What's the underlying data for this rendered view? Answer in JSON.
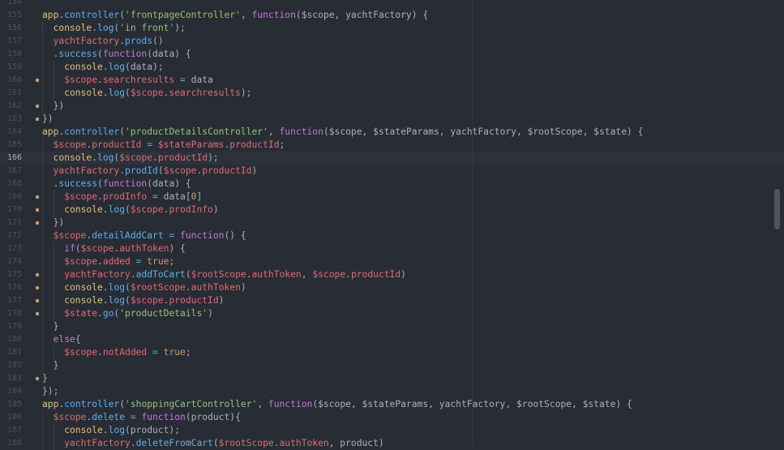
{
  "editor": {
    "current_line": 166,
    "lines": [
      {
        "num": 154,
        "indent": 0,
        "mark": false,
        "tokens": []
      },
      {
        "num": 155,
        "indent": 0,
        "mark": false,
        "tokens": [
          {
            "t": "app",
            "c": "y"
          },
          {
            "t": ".",
            "c": "p"
          },
          {
            "t": "controller",
            "c": "fn"
          },
          {
            "t": "(",
            "c": "p"
          },
          {
            "t": "'frontpageController'",
            "c": "s"
          },
          {
            "t": ", ",
            "c": "p"
          },
          {
            "t": "function",
            "c": "k"
          },
          {
            "t": "($scope, yachtFactory) {",
            "c": "p"
          }
        ]
      },
      {
        "num": 156,
        "indent": 1,
        "mark": false,
        "tokens": [
          {
            "t": "console",
            "c": "y"
          },
          {
            "t": ".",
            "c": "p"
          },
          {
            "t": "log",
            "c": "fn"
          },
          {
            "t": "(",
            "c": "p"
          },
          {
            "t": "'in front'",
            "c": "s"
          },
          {
            "t": ");",
            "c": "p"
          }
        ]
      },
      {
        "num": 157,
        "indent": 1,
        "mark": false,
        "tokens": [
          {
            "t": "yachtFactory",
            "c": "v"
          },
          {
            "t": ".",
            "c": "p"
          },
          {
            "t": "prods",
            "c": "fn"
          },
          {
            "t": "()",
            "c": "p"
          }
        ]
      },
      {
        "num": 158,
        "indent": 1,
        "mark": false,
        "tokens": [
          {
            "t": ".",
            "c": "p"
          },
          {
            "t": "success",
            "c": "fn"
          },
          {
            "t": "(",
            "c": "p"
          },
          {
            "t": "function",
            "c": "k"
          },
          {
            "t": "(data) {",
            "c": "p"
          }
        ]
      },
      {
        "num": 159,
        "indent": 2,
        "mark": false,
        "tokens": [
          {
            "t": "console",
            "c": "y"
          },
          {
            "t": ".",
            "c": "p"
          },
          {
            "t": "log",
            "c": "fn"
          },
          {
            "t": "(data);",
            "c": "p"
          }
        ]
      },
      {
        "num": 160,
        "indent": 2,
        "mark": true,
        "tokens": [
          {
            "t": "$scope",
            "c": "v"
          },
          {
            "t": ".",
            "c": "p"
          },
          {
            "t": "searchresults",
            "c": "v"
          },
          {
            "t": " = ",
            "c": "o"
          },
          {
            "t": "data",
            "c": "p"
          }
        ]
      },
      {
        "num": 161,
        "indent": 2,
        "mark": false,
        "tokens": [
          {
            "t": "console",
            "c": "y"
          },
          {
            "t": ".",
            "c": "p"
          },
          {
            "t": "log",
            "c": "fn"
          },
          {
            "t": "(",
            "c": "p"
          },
          {
            "t": "$scope",
            "c": "v"
          },
          {
            "t": ".",
            "c": "p"
          },
          {
            "t": "searchresults",
            "c": "v"
          },
          {
            "t": ");",
            "c": "p"
          }
        ]
      },
      {
        "num": 162,
        "indent": 1,
        "mark": true,
        "tokens": [
          {
            "t": "})",
            "c": "p"
          }
        ]
      },
      {
        "num": 163,
        "indent": 0,
        "mark": true,
        "tokens": [
          {
            "t": "})",
            "c": "p"
          }
        ]
      },
      {
        "num": 164,
        "indent": 0,
        "mark": false,
        "tokens": [
          {
            "t": "app",
            "c": "y"
          },
          {
            "t": ".",
            "c": "p"
          },
          {
            "t": "controller",
            "c": "fn"
          },
          {
            "t": "(",
            "c": "p"
          },
          {
            "t": "'productDetailsController'",
            "c": "s"
          },
          {
            "t": ", ",
            "c": "p"
          },
          {
            "t": "function",
            "c": "k"
          },
          {
            "t": "($scope, $stateParams, yachtFactory, $rootScope, $state) {",
            "c": "p"
          }
        ]
      },
      {
        "num": 165,
        "indent": 1,
        "mark": false,
        "tokens": [
          {
            "t": "$scope",
            "c": "v"
          },
          {
            "t": ".",
            "c": "p"
          },
          {
            "t": "productId",
            "c": "v"
          },
          {
            "t": " = ",
            "c": "o"
          },
          {
            "t": "$stateParams",
            "c": "v"
          },
          {
            "t": ".",
            "c": "p"
          },
          {
            "t": "productId",
            "c": "v"
          },
          {
            "t": ";",
            "c": "p"
          }
        ]
      },
      {
        "num": 166,
        "indent": 1,
        "mark": false,
        "tokens": [
          {
            "t": "console",
            "c": "y"
          },
          {
            "t": ".",
            "c": "p"
          },
          {
            "t": "log",
            "c": "fn"
          },
          {
            "t": "(",
            "c": "p"
          },
          {
            "t": "$scope",
            "c": "v"
          },
          {
            "t": ".",
            "c": "p"
          },
          {
            "t": "productId",
            "c": "v"
          },
          {
            "t": ");",
            "c": "p"
          }
        ]
      },
      {
        "num": 167,
        "indent": 1,
        "mark": false,
        "tokens": [
          {
            "t": "yachtFactory",
            "c": "v"
          },
          {
            "t": ".",
            "c": "p"
          },
          {
            "t": "prodId",
            "c": "fn"
          },
          {
            "t": "(",
            "c": "p"
          },
          {
            "t": "$scope",
            "c": "v"
          },
          {
            "t": ".",
            "c": "p"
          },
          {
            "t": "productId",
            "c": "v"
          },
          {
            "t": ")",
            "c": "p"
          }
        ]
      },
      {
        "num": 168,
        "indent": 1,
        "mark": false,
        "tokens": [
          {
            "t": ".",
            "c": "p"
          },
          {
            "t": "success",
            "c": "fn"
          },
          {
            "t": "(",
            "c": "p"
          },
          {
            "t": "function",
            "c": "k"
          },
          {
            "t": "(data) {",
            "c": "p"
          }
        ]
      },
      {
        "num": 169,
        "indent": 2,
        "mark": true,
        "tokens": [
          {
            "t": "$scope",
            "c": "v"
          },
          {
            "t": ".",
            "c": "p"
          },
          {
            "t": "prodInfo",
            "c": "v"
          },
          {
            "t": " = ",
            "c": "o"
          },
          {
            "t": "data[",
            "c": "p"
          },
          {
            "t": "0",
            "c": "n"
          },
          {
            "t": "]",
            "c": "p"
          }
        ]
      },
      {
        "num": 170,
        "indent": 2,
        "mark": true,
        "tokens": [
          {
            "t": "console",
            "c": "y"
          },
          {
            "t": ".",
            "c": "p"
          },
          {
            "t": "log",
            "c": "fn"
          },
          {
            "t": "(",
            "c": "p"
          },
          {
            "t": "$scope",
            "c": "v"
          },
          {
            "t": ".",
            "c": "p"
          },
          {
            "t": "prodInfo",
            "c": "v"
          },
          {
            "t": ")",
            "c": "p"
          }
        ]
      },
      {
        "num": 171,
        "indent": 1,
        "mark": true,
        "tokens": [
          {
            "t": "})",
            "c": "p"
          }
        ]
      },
      {
        "num": 172,
        "indent": 1,
        "mark": false,
        "tokens": [
          {
            "t": "$scope",
            "c": "v"
          },
          {
            "t": ".",
            "c": "p"
          },
          {
            "t": "detailAddCart",
            "c": "fn"
          },
          {
            "t": " = ",
            "c": "o"
          },
          {
            "t": "function",
            "c": "k"
          },
          {
            "t": "() {",
            "c": "p"
          }
        ]
      },
      {
        "num": 173,
        "indent": 2,
        "mark": false,
        "tokens": [
          {
            "t": "if",
            "c": "k"
          },
          {
            "t": "(",
            "c": "p"
          },
          {
            "t": "$scope",
            "c": "v"
          },
          {
            "t": ".",
            "c": "p"
          },
          {
            "t": "authToken",
            "c": "v"
          },
          {
            "t": ") {",
            "c": "p"
          }
        ]
      },
      {
        "num": 174,
        "indent": 2,
        "mark": false,
        "tokens": [
          {
            "t": "$scope",
            "c": "v"
          },
          {
            "t": ".",
            "c": "p"
          },
          {
            "t": "added",
            "c": "v"
          },
          {
            "t": " = ",
            "c": "o"
          },
          {
            "t": "true",
            "c": "n"
          },
          {
            "t": ";",
            "c": "p"
          }
        ]
      },
      {
        "num": 175,
        "indent": 2,
        "mark": true,
        "tokens": [
          {
            "t": "yachtFactory",
            "c": "v"
          },
          {
            "t": ".",
            "c": "p"
          },
          {
            "t": "addToCart",
            "c": "fn"
          },
          {
            "t": "(",
            "c": "p"
          },
          {
            "t": "$rootScope",
            "c": "v"
          },
          {
            "t": ".",
            "c": "p"
          },
          {
            "t": "authToken",
            "c": "v"
          },
          {
            "t": ", ",
            "c": "p"
          },
          {
            "t": "$scope",
            "c": "v"
          },
          {
            "t": ".",
            "c": "p"
          },
          {
            "t": "productId",
            "c": "v"
          },
          {
            "t": ")",
            "c": "p"
          }
        ]
      },
      {
        "num": 176,
        "indent": 2,
        "mark": true,
        "tokens": [
          {
            "t": "console",
            "c": "y"
          },
          {
            "t": ".",
            "c": "p"
          },
          {
            "t": "log",
            "c": "fn"
          },
          {
            "t": "(",
            "c": "p"
          },
          {
            "t": "$rootScope",
            "c": "v"
          },
          {
            "t": ".",
            "c": "p"
          },
          {
            "t": "authToken",
            "c": "v"
          },
          {
            "t": ")",
            "c": "p"
          }
        ]
      },
      {
        "num": 177,
        "indent": 2,
        "mark": true,
        "tokens": [
          {
            "t": "console",
            "c": "y"
          },
          {
            "t": ".",
            "c": "p"
          },
          {
            "t": "log",
            "c": "fn"
          },
          {
            "t": "(",
            "c": "p"
          },
          {
            "t": "$scope",
            "c": "v"
          },
          {
            "t": ".",
            "c": "p"
          },
          {
            "t": "productId",
            "c": "v"
          },
          {
            "t": ")",
            "c": "p"
          }
        ]
      },
      {
        "num": 178,
        "indent": 2,
        "mark": true,
        "tokens": [
          {
            "t": "$state",
            "c": "v"
          },
          {
            "t": ".",
            "c": "p"
          },
          {
            "t": "go",
            "c": "fn"
          },
          {
            "t": "(",
            "c": "p"
          },
          {
            "t": "'productDetails'",
            "c": "s"
          },
          {
            "t": ")",
            "c": "p"
          }
        ]
      },
      {
        "num": 179,
        "indent": 1,
        "mark": false,
        "tokens": [
          {
            "t": "}",
            "c": "p"
          }
        ]
      },
      {
        "num": 180,
        "indent": 1,
        "mark": false,
        "tokens": [
          {
            "t": "else",
            "c": "k"
          },
          {
            "t": "{",
            "c": "p"
          }
        ]
      },
      {
        "num": 181,
        "indent": 2,
        "mark": false,
        "tokens": [
          {
            "t": "$scope",
            "c": "v"
          },
          {
            "t": ".",
            "c": "p"
          },
          {
            "t": "notAdded",
            "c": "v"
          },
          {
            "t": " = ",
            "c": "o"
          },
          {
            "t": "true",
            "c": "n"
          },
          {
            "t": ";",
            "c": "p"
          }
        ]
      },
      {
        "num": 182,
        "indent": 1,
        "mark": false,
        "tokens": [
          {
            "t": "}",
            "c": "p"
          }
        ]
      },
      {
        "num": 183,
        "indent": 0,
        "mark": true,
        "tokens": [
          {
            "t": "}",
            "c": "p"
          }
        ]
      },
      {
        "num": 184,
        "indent": 0,
        "mark": false,
        "tokens": [
          {
            "t": "});",
            "c": "p"
          }
        ]
      },
      {
        "num": 185,
        "indent": 0,
        "mark": false,
        "tokens": [
          {
            "t": "app",
            "c": "y"
          },
          {
            "t": ".",
            "c": "p"
          },
          {
            "t": "controller",
            "c": "fn"
          },
          {
            "t": "(",
            "c": "p"
          },
          {
            "t": "'shoppingCartController'",
            "c": "s"
          },
          {
            "t": ", ",
            "c": "p"
          },
          {
            "t": "function",
            "c": "k"
          },
          {
            "t": "($scope, $stateParams, yachtFactory, $rootScope, $state) {",
            "c": "p"
          }
        ]
      },
      {
        "num": 186,
        "indent": 1,
        "mark": false,
        "tokens": [
          {
            "t": "$scope",
            "c": "v"
          },
          {
            "t": ".",
            "c": "p"
          },
          {
            "t": "delete",
            "c": "fn"
          },
          {
            "t": " = ",
            "c": "o"
          },
          {
            "t": "function",
            "c": "k"
          },
          {
            "t": "(product){",
            "c": "p"
          }
        ]
      },
      {
        "num": 187,
        "indent": 2,
        "mark": false,
        "tokens": [
          {
            "t": "console",
            "c": "y"
          },
          {
            "t": ".",
            "c": "p"
          },
          {
            "t": "log",
            "c": "fn"
          },
          {
            "t": "(product);",
            "c": "p"
          }
        ]
      },
      {
        "num": 188,
        "indent": 2,
        "mark": false,
        "tokens": [
          {
            "t": "yachtFactory",
            "c": "v"
          },
          {
            "t": ".",
            "c": "p"
          },
          {
            "t": "deleteFromCart",
            "c": "fn"
          },
          {
            "t": "(",
            "c": "p"
          },
          {
            "t": "$rootScope",
            "c": "v"
          },
          {
            "t": ".",
            "c": "p"
          },
          {
            "t": "authToken",
            "c": "v"
          },
          {
            "t": ", product)",
            "c": "p"
          }
        ]
      }
    ]
  }
}
